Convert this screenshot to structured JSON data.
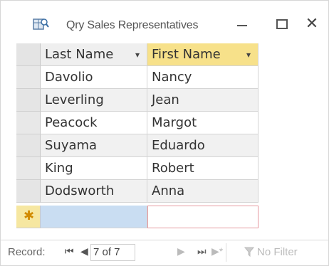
{
  "window": {
    "title": "Qry Sales Representatives",
    "icon": "query-icon",
    "minimize_icon": "minimize-icon",
    "maximize_icon": "maximize-icon",
    "close_glyph": "✕"
  },
  "grid": {
    "columns": [
      {
        "label": "Last Name",
        "sort_glyph": "▾"
      },
      {
        "label": "First Name",
        "sort_glyph": "▾"
      }
    ],
    "rows": [
      {
        "last": "Davolio",
        "first": "Nancy"
      },
      {
        "last": "Leverling",
        "first": "Jean"
      },
      {
        "last": "Peacock",
        "first": "Margot"
      },
      {
        "last": "Suyama",
        "first": "Eduardo"
      },
      {
        "last": "King",
        "first": "Robert"
      },
      {
        "last": "Dodsworth",
        "first": "Anna"
      }
    ],
    "new_row_marker": "✱"
  },
  "navigation": {
    "record_label": "Record:",
    "first_glyph": "⏮",
    "prev_glyph": "◀",
    "position_text": "7 of 7",
    "next_glyph": "▶",
    "last_glyph": "⏭",
    "new_glyph": "▶*",
    "filter_label": "No Filter"
  },
  "colors": {
    "active_header": "#f7e18a",
    "new_row_selector": "#f6e7a1",
    "selected_cell": "#c9ddf2",
    "focus_border": "#e69aa0"
  }
}
